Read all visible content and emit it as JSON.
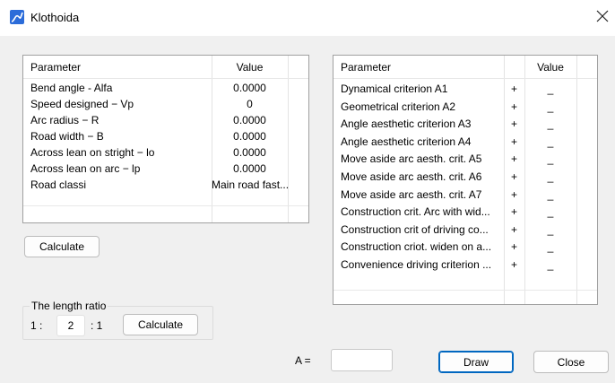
{
  "window": {
    "title": "Klothoida",
    "icon": "klothoid-curve-icon",
    "close_icon": "close-icon"
  },
  "left_table": {
    "columns": [
      "Parameter",
      "Value"
    ],
    "rows": [
      {
        "parameter": "Bend angle - Alfa",
        "value": "0.0000"
      },
      {
        "parameter": "Speed designed − Vp",
        "value": "0"
      },
      {
        "parameter": "Arc radius − R",
        "value": "0.0000"
      },
      {
        "parameter": "Road width − B",
        "value": "0.0000"
      },
      {
        "parameter": "Across lean on stright − lo",
        "value": "0.0000"
      },
      {
        "parameter": "Across lean on arc − lp",
        "value": "0.0000"
      },
      {
        "parameter": "Road classi",
        "value": "Main road fast..."
      }
    ]
  },
  "calculate_button_label": "Calculate",
  "length_ratio": {
    "title": "The length ratio",
    "prefix": "1 :",
    "value": "2",
    "suffix": ": 1",
    "calculate_label": "Calculate"
  },
  "right_table": {
    "columns": [
      "Parameter",
      "",
      "Value"
    ],
    "rows": [
      {
        "parameter": "Dynamical criterion A1",
        "flag": "+",
        "value": "_"
      },
      {
        "parameter": "Geometrical criterion A2",
        "flag": "+",
        "value": "_"
      },
      {
        "parameter": "Angle aesthetic criterion A3",
        "flag": "+",
        "value": "_"
      },
      {
        "parameter": "Angle aesthetic criterion A4",
        "flag": "+",
        "value": "_"
      },
      {
        "parameter": "Move aside arc aesth. crit.  A5",
        "flag": "+",
        "value": "_"
      },
      {
        "parameter": "Move aside arc aesth. crit.  A6",
        "flag": "+",
        "value": "_"
      },
      {
        "parameter": "Move aside arc aesth. crit. A7",
        "flag": "+",
        "value": "_"
      },
      {
        "parameter": "Construction crit. Arc with wid...",
        "flag": "+",
        "value": "_"
      },
      {
        "parameter": "Construction crit of driving co...",
        "flag": "+",
        "value": "_"
      },
      {
        "parameter": "Construction criot. widen on  a...",
        "flag": "+",
        "value": "_"
      },
      {
        "parameter": "Convenience driving criterion ...",
        "flag": "+",
        "value": "_"
      }
    ]
  },
  "a_field": {
    "label": "A =",
    "value": ""
  },
  "draw_label": "Draw",
  "close_label": "Close",
  "colors": {
    "accent": "#0067c0",
    "background": "#f0f0f0"
  }
}
